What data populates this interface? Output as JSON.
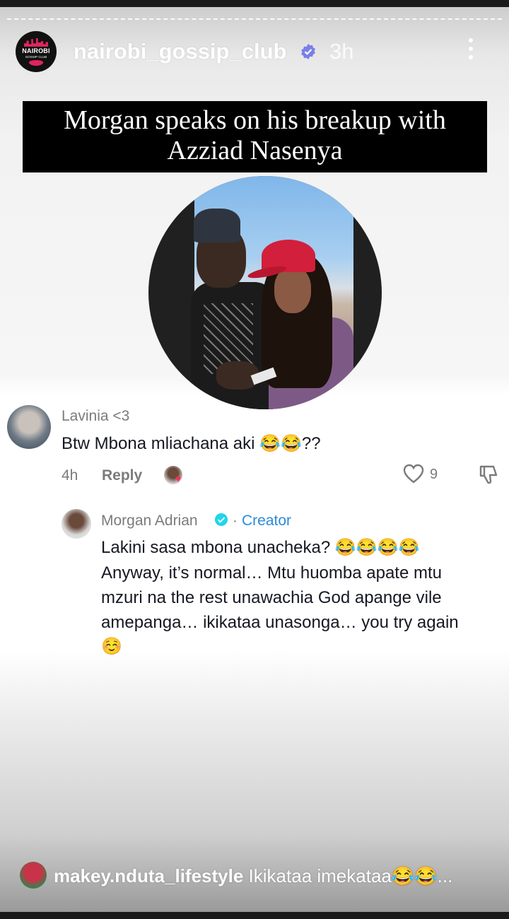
{
  "story": {
    "account": {
      "username": "nairobi_gossip_club",
      "time": "3h",
      "logo_text": "NAIROBI",
      "logo_subtext": "GOSSIP CLUB"
    },
    "title_line1": "Morgan speaks on his breakup with",
    "title_line2": "Azziad Nasenya"
  },
  "comment": {
    "author": "Lavinia <3",
    "text": "Btw Mbona mliachana aki 😂😂??",
    "time": "4h",
    "reply_label": "Reply",
    "likes": "9"
  },
  "reply": {
    "author": "Morgan Adrian",
    "separator": "·",
    "badge": "Creator",
    "line1": "Lakini sasa mbona unacheka? 😂😂😂😂",
    "line2": "Anyway, it’s normal… Mtu huomba apate mtu",
    "line3": "mzuri na the rest unawachia God apange vile",
    "line4": "amepanga… ikikataa unasonga… you try again",
    "line5": "☺️"
  },
  "bottom_comment": {
    "username": "makey.nduta_lifestyle",
    "text": "Ikikataa imekataa😂😂..."
  },
  "colors": {
    "accent_link": "#2b8ad8",
    "verified": "#7a7fe8",
    "heart": "#fe2c55"
  }
}
